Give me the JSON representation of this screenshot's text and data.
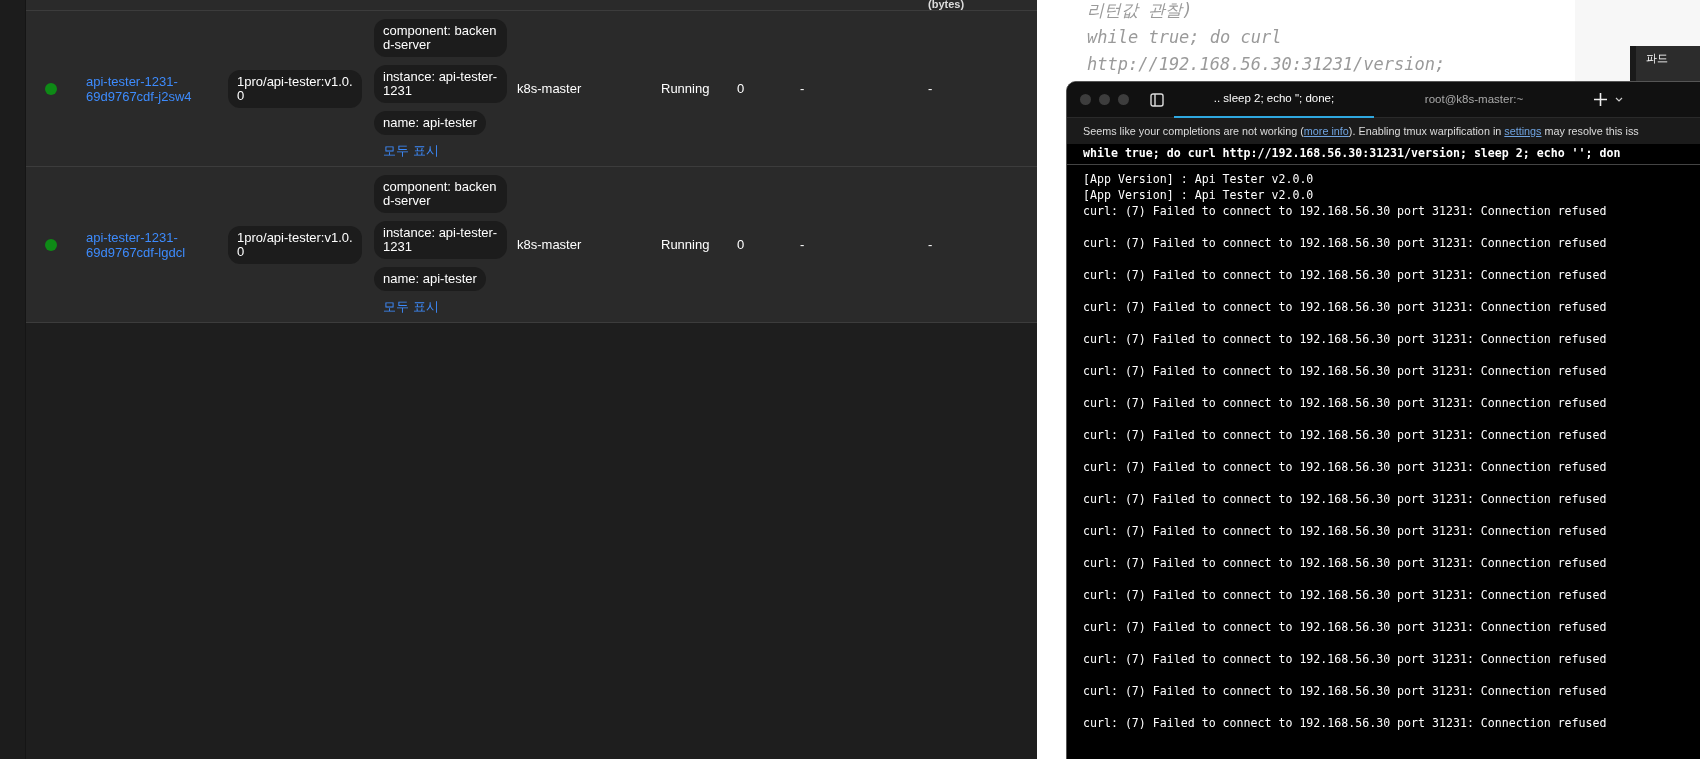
{
  "pods_table": {
    "header_cut": "(bytes)",
    "rows": [
      {
        "color": "#0e8a16",
        "name": "api-tester-1231-69d9767cdf-j2sw4",
        "image": "1pro/api-tester:v1.0.0",
        "labels": [
          "component: backend-server",
          "instance: api-tester-1231",
          "name: api-tester"
        ],
        "show_all": "모두 표시",
        "node": "k8s-master",
        "status": "Running",
        "restarts": "0",
        "column_8": "-",
        "column_9": "-"
      },
      {
        "color": "#0e8a16",
        "name": "api-tester-1231-69d9767cdf-lgdcl",
        "image": "1pro/api-tester:v1.0.0",
        "labels": [
          "component: backend-server",
          "instance: api-tester-1231",
          "name: api-tester"
        ],
        "show_all": "모두 표시",
        "node": "k8s-master",
        "status": "Running",
        "restarts": "0",
        "column_8": "-",
        "column_9": "-"
      }
    ]
  },
  "notes": {
    "lines": [
      "리턴값 관찰)",
      "while true; do curl",
      "http://192.168.56.30:31231/version;"
    ]
  },
  "side_panel": {
    "label": "파드"
  },
  "terminal": {
    "tabs": [
      {
        "label": ".. sleep 2; echo \"; done;",
        "selected": true
      },
      {
        "label": "root@k8s-master:~",
        "selected": false
      }
    ],
    "banner": [
      {
        "kind": "text",
        "text": "Seems like your completions are not working ("
      },
      {
        "kind": "link",
        "text": "more info"
      },
      {
        "kind": "text",
        "text": "). Enabling tmux warpification in "
      },
      {
        "kind": "link",
        "text": "settings"
      },
      {
        "kind": "text",
        "text": " may resolve this iss"
      }
    ],
    "command": "while true; do curl http://192.168.56.30:31231/version; sleep 2; echo ''; don",
    "output": [
      {
        "kind": "info",
        "text": "[App Version] : Api Tester v2.0.0"
      },
      {
        "kind": "info",
        "text": "[App Version] : Api Tester v2.0.0"
      },
      {
        "kind": "error",
        "text": "curl: (7) Failed to connect to 192.168.56.30 port 31231: Connection refused"
      },
      {
        "kind": "error",
        "text": "curl: (7) Failed to connect to 192.168.56.30 port 31231: Connection refused"
      },
      {
        "kind": "error",
        "text": "curl: (7) Failed to connect to 192.168.56.30 port 31231: Connection refused"
      },
      {
        "kind": "error",
        "text": "curl: (7) Failed to connect to 192.168.56.30 port 31231: Connection refused"
      },
      {
        "kind": "error",
        "text": "curl: (7) Failed to connect to 192.168.56.30 port 31231: Connection refused"
      },
      {
        "kind": "error",
        "text": "curl: (7) Failed to connect to 192.168.56.30 port 31231: Connection refused"
      },
      {
        "kind": "error",
        "text": "curl: (7) Failed to connect to 192.168.56.30 port 31231: Connection refused"
      },
      {
        "kind": "error",
        "text": "curl: (7) Failed to connect to 192.168.56.30 port 31231: Connection refused"
      },
      {
        "kind": "error",
        "text": "curl: (7) Failed to connect to 192.168.56.30 port 31231: Connection refused"
      },
      {
        "kind": "error",
        "text": "curl: (7) Failed to connect to 192.168.56.30 port 31231: Connection refused"
      },
      {
        "kind": "error",
        "text": "curl: (7) Failed to connect to 192.168.56.30 port 31231: Connection refused"
      },
      {
        "kind": "error",
        "text": "curl: (7) Failed to connect to 192.168.56.30 port 31231: Connection refused"
      },
      {
        "kind": "error",
        "text": "curl: (7) Failed to connect to 192.168.56.30 port 31231: Connection refused"
      },
      {
        "kind": "error",
        "text": "curl: (7) Failed to connect to 192.168.56.30 port 31231: Connection refused"
      },
      {
        "kind": "error",
        "text": "curl: (7) Failed to connect to 192.168.56.30 port 31231: Connection refused"
      },
      {
        "kind": "error",
        "text": "curl: (7) Failed to connect to 192.168.56.30 port 31231: Connection refused"
      },
      {
        "kind": "error",
        "text": "curl: (7) Failed to connect to 192.168.56.30 port 31231: Connection refused"
      }
    ]
  }
}
